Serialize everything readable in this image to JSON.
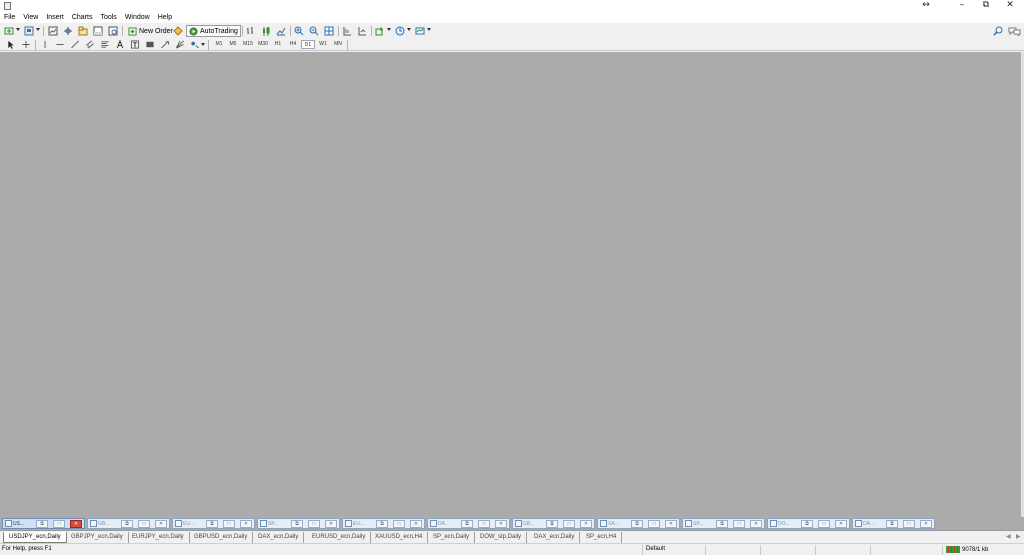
{
  "window": {
    "controls": {
      "resize": "↔",
      "minimize": "–",
      "restore": "⧉",
      "close": "✕"
    }
  },
  "menu": [
    "File",
    "View",
    "Insert",
    "Charts",
    "Tools",
    "Window",
    "Help"
  ],
  "toolbar": {
    "new_order_label": "New Order",
    "autotrading_label": "AutoTrading",
    "timeframes": [
      "M1",
      "M5",
      "M15",
      "M30",
      "H1",
      "H4",
      "D1",
      "W1",
      "MN"
    ],
    "active_timeframe": "D1"
  },
  "minimized_windows": [
    {
      "title": "US...",
      "active": true
    },
    {
      "title": "GB...",
      "active": false
    },
    {
      "title": "EU...",
      "active": false
    },
    {
      "title": "SP...",
      "active": false
    },
    {
      "title": "EU...",
      "active": false
    },
    {
      "title": "DA...",
      "active": false
    },
    {
      "title": "GB...",
      "active": false
    },
    {
      "title": "XA...",
      "active": false
    },
    {
      "title": "SP...",
      "active": false
    },
    {
      "title": "DO...",
      "active": false
    },
    {
      "title": "DA...",
      "active": false
    }
  ],
  "chart_tabs": [
    {
      "label": "USDJPY_ecn,Daily",
      "active": true
    },
    {
      "label": "GBPJPY_ecn,Daily",
      "active": false
    },
    {
      "label": "EURJPY_ecn,Daily",
      "active": false
    },
    {
      "label": "GBPUSD_ecn,Daily",
      "active": false
    },
    {
      "label": "DAX_ecn,Daily",
      "active": false
    },
    {
      "label": "EURUSD_ecn,Daily",
      "active": false
    },
    {
      "label": "XAUUSD_ecn,H4",
      "active": false
    },
    {
      "label": "SP_ecn,Daily",
      "active": false
    },
    {
      "label": "DOW_stp,Daily",
      "active": false
    },
    {
      "label": "DAX_ecn,Daily",
      "active": false
    },
    {
      "label": "SP_ecn,H4",
      "active": false
    }
  ],
  "status": {
    "help_text": "For Help, press F1",
    "profile": "Default",
    "connection": "9078/1 kb"
  },
  "colors": {
    "workspace": "#ababab",
    "accent": "#6f8eb6",
    "close_red": "#d84a3c"
  }
}
